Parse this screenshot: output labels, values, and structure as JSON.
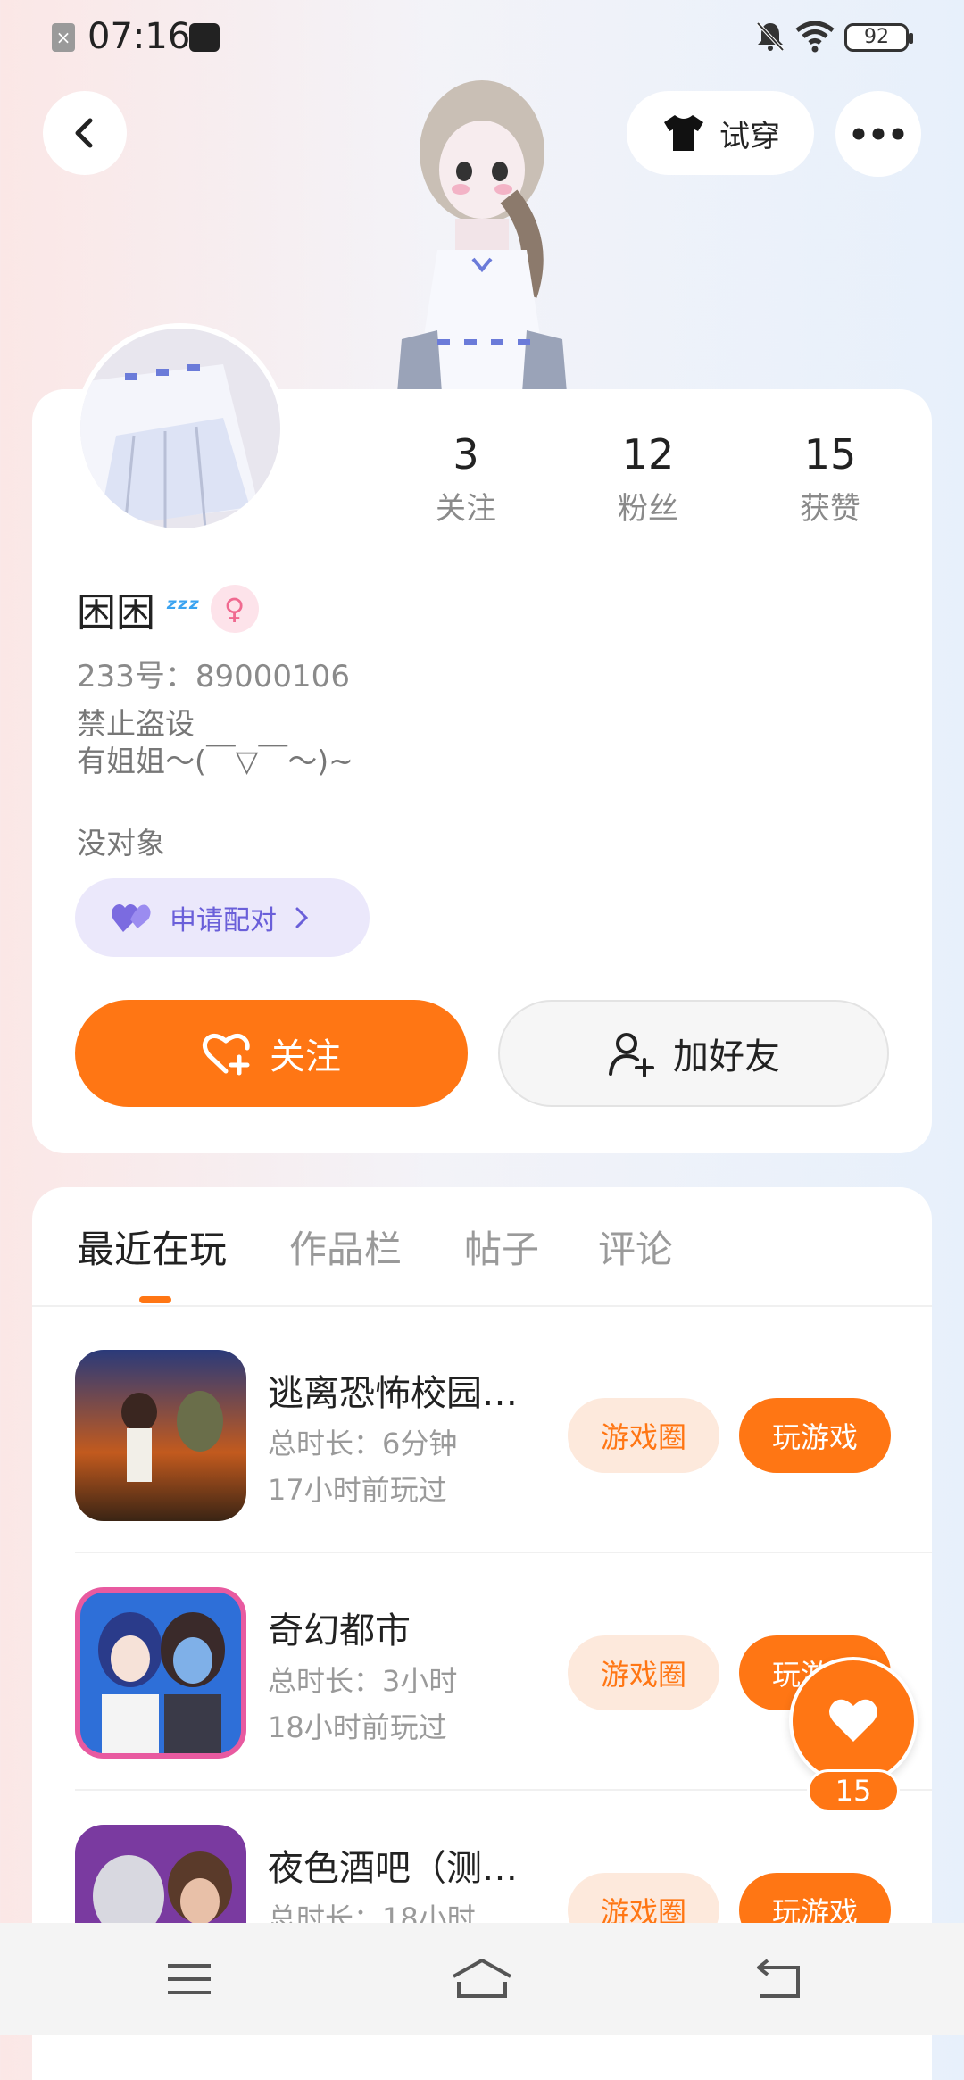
{
  "status_bar": {
    "time": "07:16",
    "battery": "92"
  },
  "header": {
    "try_on_label": "试穿"
  },
  "profile": {
    "stats": [
      {
        "value": "3",
        "label": "关注"
      },
      {
        "value": "12",
        "label": "粉丝"
      },
      {
        "value": "15",
        "label": "获赞"
      }
    ],
    "name": "困困",
    "uid": "233号：89000106",
    "bio_line1": "禁止盗设",
    "bio_line2": "有姐姐～(￣▽￣～)~",
    "relation": "没对象",
    "pair_label": "申请配对",
    "follow_label": "关注",
    "add_friend_label": "加好友"
  },
  "tabs": [
    {
      "label": "最近在玩"
    },
    {
      "label": "作品栏"
    },
    {
      "label": "帖子"
    },
    {
      "label": "评论"
    }
  ],
  "games": [
    {
      "title": "逃离恐怖校园…",
      "duration": "总时长：6分钟",
      "last_played": "17小时前玩过",
      "circle_label": "游戏圈",
      "play_label": "玩游戏"
    },
    {
      "title": "奇幻都市",
      "duration": "总时长：3小时",
      "last_played": "18小时前玩过",
      "circle_label": "游戏圈",
      "play_label": "玩游戏"
    },
    {
      "title": "夜色酒吧（测…",
      "duration": "总时长：18小时",
      "last_played": "",
      "circle_label": "游戏圈",
      "play_label": "玩游戏"
    }
  ],
  "like_fab": {
    "count": "15"
  },
  "colors": {
    "accent": "#ff7614",
    "pair_purple": "#6a5fd9"
  }
}
